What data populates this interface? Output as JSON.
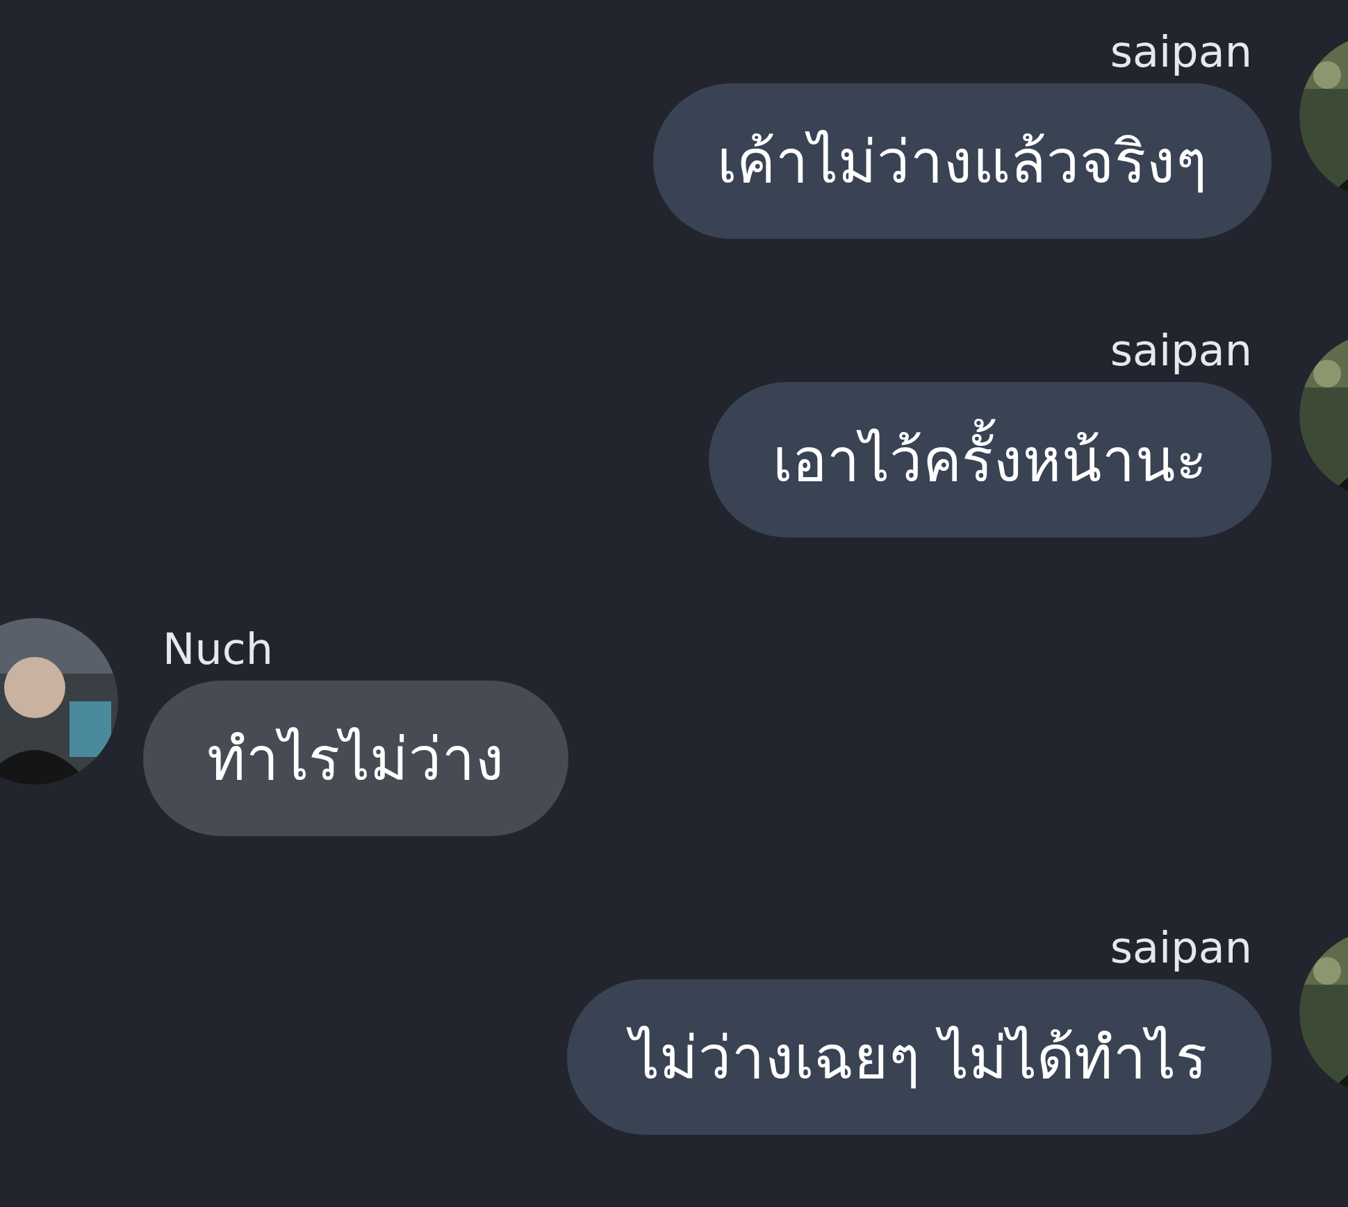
{
  "messages": [
    {
      "kind": "outgoing",
      "sender": "saipan",
      "text": "เค้าไม่ว่างแล้วจริงๆ"
    },
    {
      "kind": "outgoing",
      "sender": "saipan",
      "text": "เอาไว้ครั้งหน้านะ"
    },
    {
      "kind": "incoming",
      "sender": "Nuch",
      "text": "ทำไรไม่ว่าง"
    },
    {
      "kind": "outgoing",
      "sender": "saipan",
      "text": "ไม่ว่างเฉยๆ ไม่ได้ทำไร"
    }
  ]
}
